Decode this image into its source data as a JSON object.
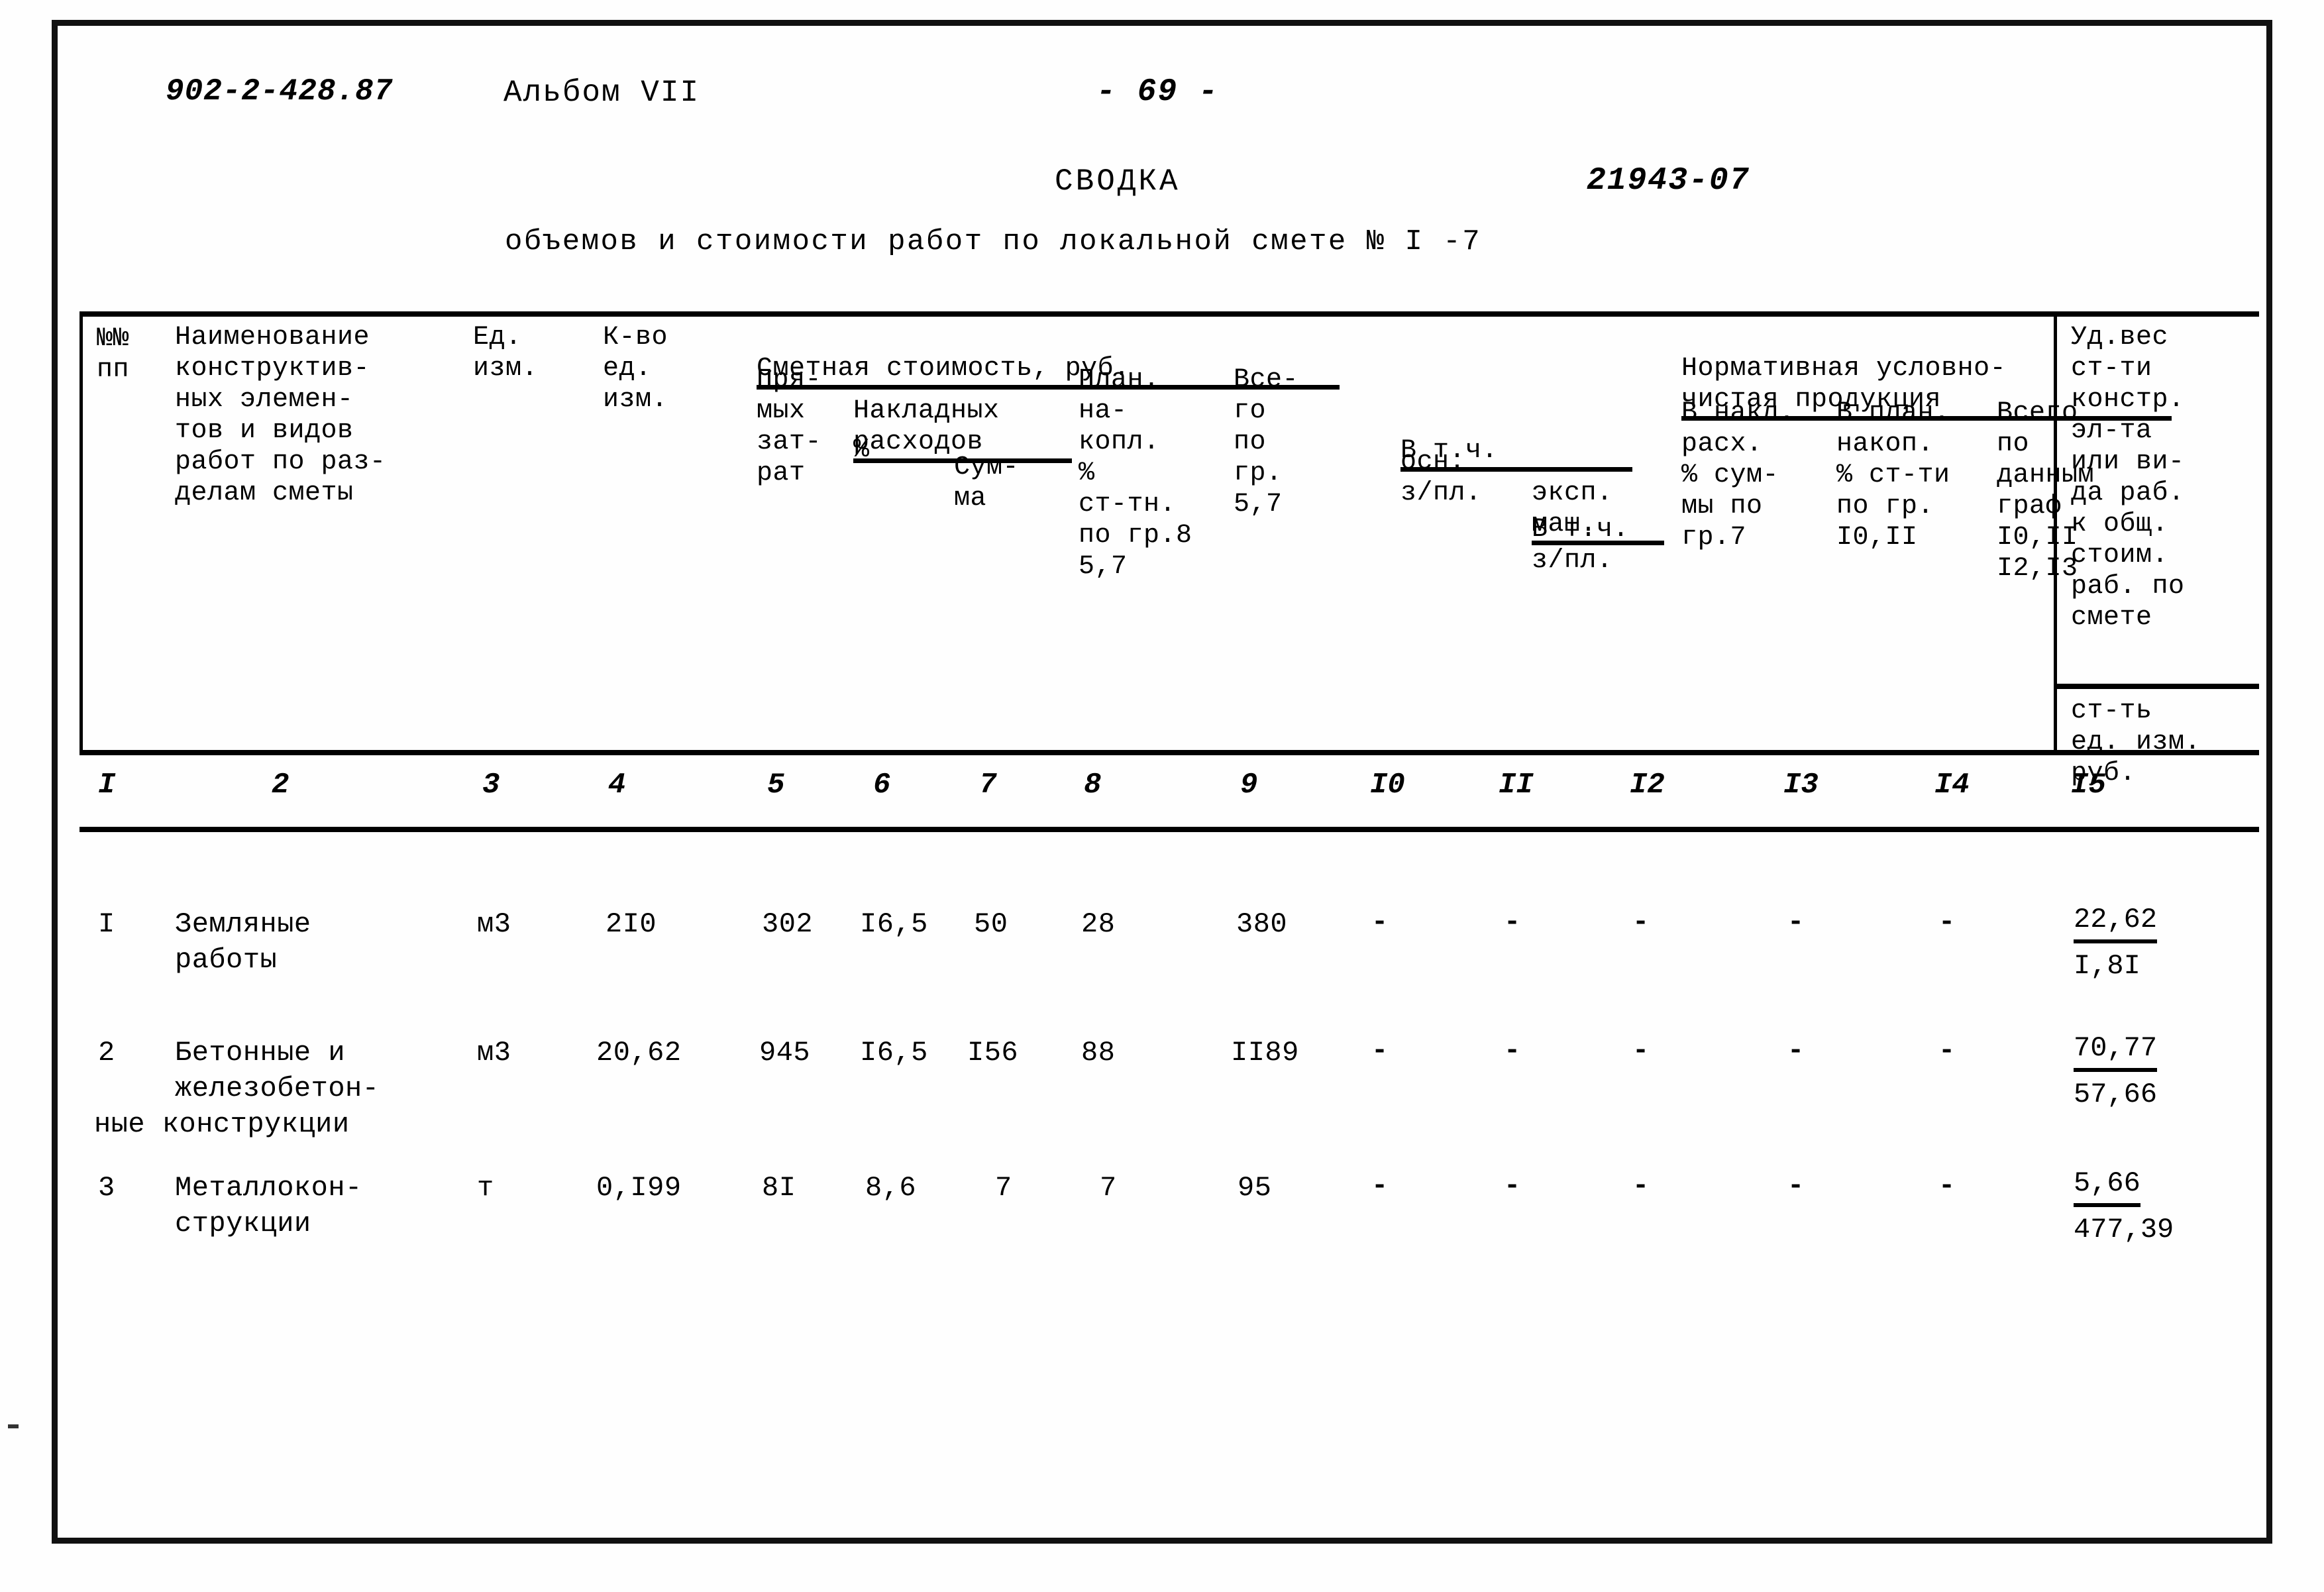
{
  "page": {
    "doc_code": "902-2-428.87",
    "album": "Альбом VII",
    "page_number": "- 69 -"
  },
  "title": {
    "main": "СВОДКА",
    "reference_number": "21943-07",
    "subtitle": "объемов и стоимости работ по локальной смете № I -7"
  },
  "table": {
    "headers": {
      "col1": "№№\nпп",
      "col2": "Наименование\nконструктив-\nных элемен-\nтов и видов\nработ по раз-\nделам сметы",
      "col3": "Ед.\nизм.",
      "col4": "К-во\nед.\nизм.",
      "group_smeta": "Сметная стоимость, руб.",
      "col5": "Пря-\nмых\nзат-\nрат",
      "group_nakladnyh": "Накладных\nрасходов",
      "col6": "%",
      "col7": "Сум-\nма",
      "col8": "План.\nна-\nкопл.\n%\nст-тн.\nпо гр.8\n5,7",
      "col9": "Все-\nго\nпо\nгр.\n5,7",
      "group_vtch": "В т.ч.",
      "col10": "осн.\nз/пл.",
      "col11_title": "эксп.\nмаш.",
      "col11_sub": "В т.ч.\nз/пл.",
      "group_nuchp": "Нормативная условно-\nчистая продукция",
      "col12": "В накл.\nрасх.\n% сум-\nмы по\nгр.7",
      "col13": "В план.\nнакоп.\n% ст-ти\nпо гр.\nI0,II",
      "col14": "Всего\nпо\nданным\nграф\nI0,II\nI2,I3",
      "col15_top": "Уд.вес\nст-ти\nконстр.\nэл-та\nили ви-\nда раб.\nк общ.\nстоим.\nраб. по\nсмете",
      "col15_bottom": "ст-ть\nед. изм.\nруб."
    },
    "column_numbers": [
      "I",
      "2",
      "3",
      "4",
      "5",
      "6",
      "7",
      "8",
      "9",
      "I0",
      "II",
      "I2",
      "I3",
      "I4",
      "I5"
    ],
    "rows": [
      {
        "no": "I",
        "name": "Земляные\nработы",
        "unit": "м3",
        "qty": "2I0",
        "direct": "302",
        "overhead_pct": "I6,5",
        "overhead_sum": "50",
        "plan_accum": "28",
        "total": "380",
        "main_wage": "-",
        "machine_exp": "-",
        "nuchp_overhead": "-",
        "nuchp_plan": "-",
        "nuchp_total": "-",
        "share_top": "22,62",
        "share_bottom": "I,8I"
      },
      {
        "no": "2",
        "name": "Бетонные и\nжелезобетон-",
        "name_overflow": "ные конструкции",
        "unit": "м3",
        "qty": "20,62",
        "direct": "945",
        "overhead_pct": "I6,5",
        "overhead_sum": "I56",
        "plan_accum": "88",
        "total": "II89",
        "main_wage": "-",
        "machine_exp": "-",
        "nuchp_overhead": "-",
        "nuchp_plan": "-",
        "nuchp_total": "-",
        "share_top": "70,77",
        "share_bottom": "57,66"
      },
      {
        "no": "3",
        "name": "Металлокон-\nструкции",
        "unit": "т",
        "qty": "0,I99",
        "direct": "8I",
        "overhead_pct": "8,6",
        "overhead_sum": "7",
        "plan_accum": "7",
        "total": "95",
        "main_wage": "-",
        "machine_exp": "-",
        "nuchp_overhead": "-",
        "nuchp_plan": "-",
        "nuchp_total": "-",
        "share_top": "5,66",
        "share_bottom": "477,39"
      }
    ]
  }
}
